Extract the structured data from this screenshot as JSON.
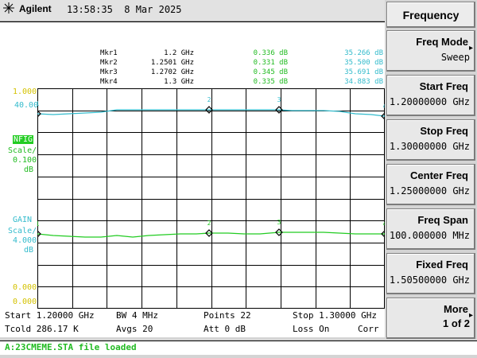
{
  "header": {
    "brand": "Agilent",
    "time": "13:58:35",
    "date": "8 Mar 2025"
  },
  "markers": [
    {
      "name": "Mkr1",
      "freq": "1.2 GHz",
      "nf": "0.336 dB",
      "gain": "35.266 dB"
    },
    {
      "name": "Mkr2",
      "freq": "1.2501 GHz",
      "nf": "0.331 dB",
      "gain": "35.500 dB"
    },
    {
      "name": "Mkr3",
      "freq": "1.2702 GHz",
      "nf": "0.345 dB",
      "gain": "35.691 dB"
    },
    {
      "name": "Mkr4",
      "freq": "1.3 GHz",
      "nf": "0.335 dB",
      "gain": "34.883 dB"
    }
  ],
  "axes": {
    "nf_top": "1.000",
    "gain_top": "40.00",
    "nf_label": "NFIG",
    "nf_scale_1": "Scale/",
    "nf_scale_2": "0.100",
    "nf_scale_3": "dB",
    "gain_label": "GAIN",
    "gain_scale_1": "Scale/",
    "gain_scale_2": "4.000",
    "gain_scale_3": "dB",
    "ref_gain": "0.000",
    "ref_nf": "0.000"
  },
  "bottom": {
    "start": "Start 1.20000 GHz",
    "bw": "BW 4 MHz",
    "points": "Points 22",
    "stop": "Stop 1.30000 GHz",
    "tcold": "Tcold 286.17 K",
    "avgs": "Avgs 20",
    "att": "Att 0 dB",
    "loss": "Loss On",
    "corr": "Corr"
  },
  "status": "A:23CMEME.STA file loaded",
  "softkeys": {
    "title": "Frequency",
    "items": [
      {
        "label": "Freq Mode",
        "value": "Sweep"
      },
      {
        "label": "Start Freq",
        "value": "1.20000000 GHz"
      },
      {
        "label": "Stop Freq",
        "value": "1.30000000 GHz"
      },
      {
        "label": "Center Freq",
        "value": "1.25000000 GHz"
      },
      {
        "label": "Freq Span",
        "value": "100.000000 MHz"
      },
      {
        "label": "Fixed Freq",
        "value": "1.50500000 GHz"
      },
      {
        "label": "More",
        "value": "1 of 2"
      }
    ]
  },
  "colors": {
    "nf_trace": "#22cc22",
    "gain_trace": "#33bbcc",
    "grid": "#000000",
    "label_yellow": "#d4c200"
  }
}
